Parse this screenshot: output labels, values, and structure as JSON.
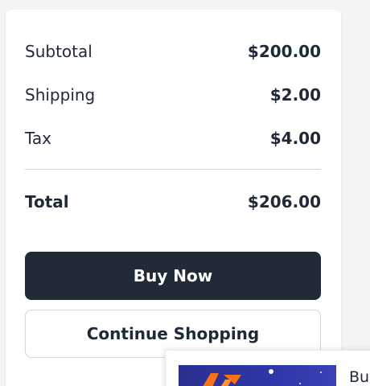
{
  "summary": {
    "subtotal_label": "Subtotal",
    "subtotal_value": "$200.00",
    "shipping_label": "Shipping",
    "shipping_value": "$2.00",
    "tax_label": "Tax",
    "tax_value": "$4.00",
    "total_label": "Total",
    "total_value": "$206.00"
  },
  "actions": {
    "buy_label": "Buy Now",
    "continue_label": "Continue Shopping"
  },
  "promo": {
    "text": "Bui"
  },
  "colors": {
    "primary_button": "#222a38",
    "promo_thumb": "#2f36a8",
    "promo_logo": "#f97316"
  }
}
